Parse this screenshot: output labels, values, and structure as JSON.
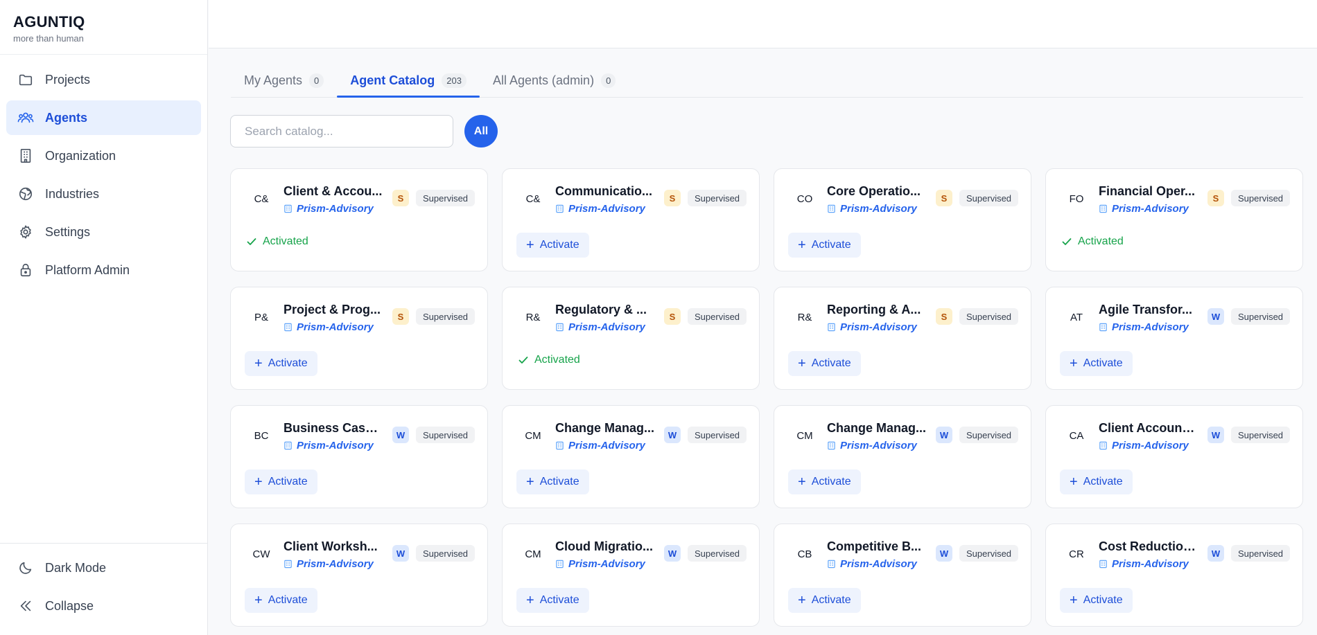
{
  "brand": {
    "name": "AGUNTIQ",
    "tagline": "more than human"
  },
  "sidebar": {
    "items": [
      {
        "label": "Projects",
        "icon": "folder-icon",
        "active": false
      },
      {
        "label": "Agents",
        "icon": "users-icon",
        "active": true
      },
      {
        "label": "Organization",
        "icon": "building-icon",
        "active": false
      },
      {
        "label": "Industries",
        "icon": "globe-icon",
        "active": false
      },
      {
        "label": "Settings",
        "icon": "gear-icon",
        "active": false
      },
      {
        "label": "Platform Admin",
        "icon": "lock-icon",
        "active": false
      }
    ],
    "bottom": [
      {
        "label": "Dark Mode",
        "icon": "moon-icon"
      },
      {
        "label": "Collapse",
        "icon": "chevrons-left-icon"
      }
    ]
  },
  "tabs": [
    {
      "label": "My Agents",
      "count": "0",
      "active": false
    },
    {
      "label": "Agent Catalog",
      "count": "203",
      "active": true
    },
    {
      "label": "All Agents (admin)",
      "count": "0",
      "active": false
    }
  ],
  "search": {
    "placeholder": "Search catalog...",
    "value": ""
  },
  "filter": {
    "all_label": "All"
  },
  "labels": {
    "activate": "Activate",
    "activated": "Activated"
  },
  "colors": {
    "accent": "#2563eb",
    "success": "#16a34a",
    "level_s_bg": "#fdf0cc",
    "level_w_bg": "#dbe7fd"
  },
  "cards": [
    {
      "abbr": "C&",
      "title": "Client & Accou...",
      "org": "Prism-Advisory",
      "level": "S",
      "mode": "Supervised",
      "activated": true
    },
    {
      "abbr": "C&",
      "title": "Communicatio...",
      "org": "Prism-Advisory",
      "level": "S",
      "mode": "Supervised",
      "activated": false
    },
    {
      "abbr": "CO",
      "title": "Core Operatio...",
      "org": "Prism-Advisory",
      "level": "S",
      "mode": "Supervised",
      "activated": false
    },
    {
      "abbr": "FO",
      "title": "Financial Oper...",
      "org": "Prism-Advisory",
      "level": "S",
      "mode": "Supervised",
      "activated": true
    },
    {
      "abbr": "P&",
      "title": "Project & Prog...",
      "org": "Prism-Advisory",
      "level": "S",
      "mode": "Supervised",
      "activated": false
    },
    {
      "abbr": "R&",
      "title": "Regulatory & ...",
      "org": "Prism-Advisory",
      "level": "S",
      "mode": "Supervised",
      "activated": true
    },
    {
      "abbr": "R&",
      "title": "Reporting & A...",
      "org": "Prism-Advisory",
      "level": "S",
      "mode": "Supervised",
      "activated": false
    },
    {
      "abbr": "AT",
      "title": "Agile Transfor...",
      "org": "Prism-Advisory",
      "level": "W",
      "mode": "Supervised",
      "activated": false
    },
    {
      "abbr": "BC",
      "title": "Business Case ...",
      "org": "Prism-Advisory",
      "level": "W",
      "mode": "Supervised",
      "activated": false
    },
    {
      "abbr": "CM",
      "title": "Change Manag...",
      "org": "Prism-Advisory",
      "level": "W",
      "mode": "Supervised",
      "activated": false
    },
    {
      "abbr": "CM",
      "title": "Change Manag...",
      "org": "Prism-Advisory",
      "level": "W",
      "mode": "Supervised",
      "activated": false
    },
    {
      "abbr": "CA",
      "title": "Client Account ...",
      "org": "Prism-Advisory",
      "level": "W",
      "mode": "Supervised",
      "activated": false
    },
    {
      "abbr": "CW",
      "title": "Client Worksh...",
      "org": "Prism-Advisory",
      "level": "W",
      "mode": "Supervised",
      "activated": false
    },
    {
      "abbr": "CM",
      "title": "Cloud Migratio...",
      "org": "Prism-Advisory",
      "level": "W",
      "mode": "Supervised",
      "activated": false
    },
    {
      "abbr": "CB",
      "title": "Competitive B...",
      "org": "Prism-Advisory",
      "level": "W",
      "mode": "Supervised",
      "activated": false
    },
    {
      "abbr": "CR",
      "title": "Cost Reduction...",
      "org": "Prism-Advisory",
      "level": "W",
      "mode": "Supervised",
      "activated": false
    }
  ]
}
